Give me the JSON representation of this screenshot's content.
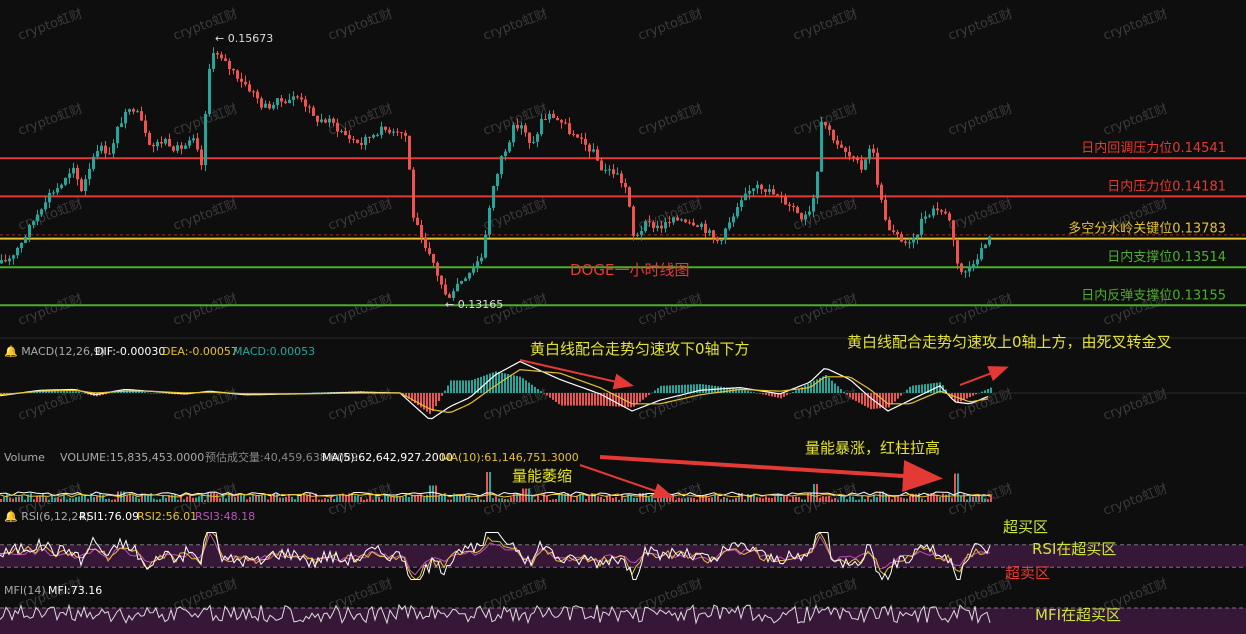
{
  "chart_data": {
    "type": "candlestick",
    "title": "DOGE一小时线图",
    "watermark": "crypto虹财",
    "price_range": [
      0.1296,
      0.159
    ],
    "high_marker": "← 0.15673",
    "low_marker": "← 0.13165",
    "levels": [
      {
        "label": "日内回调压力位0.14541",
        "value": 0.14541,
        "color": "#e53935"
      },
      {
        "label": "日内压力位0.14181",
        "value": 0.14181,
        "color": "#e53935"
      },
      {
        "label": "多空分水岭关键位0.13783",
        "value": 0.13783,
        "color": "#e5c22e"
      },
      {
        "label": "日内支撑位0.13514",
        "value": 0.13514,
        "color": "#4caf2a"
      },
      {
        "label": "日内反弹支撑位0.13155",
        "value": 0.13155,
        "color": "#4caf2a"
      }
    ],
    "price_anchors": [
      [
        0,
        0.1355
      ],
      [
        10,
        0.1362
      ],
      [
        25,
        0.1383
      ],
      [
        45,
        0.1418
      ],
      [
        60,
        0.143
      ],
      [
        72,
        0.1442
      ],
      [
        80,
        0.1425
      ],
      [
        95,
        0.1465
      ],
      [
        110,
        0.146
      ],
      [
        118,
        0.1488
      ],
      [
        135,
        0.1505
      ],
      [
        150,
        0.1465
      ],
      [
        165,
        0.1472
      ],
      [
        175,
        0.1462
      ],
      [
        192,
        0.147
      ],
      [
        200,
        0.1448
      ],
      [
        210,
        0.156
      ],
      [
        218,
        0.1548
      ],
      [
        230,
        0.1538
      ],
      [
        250,
        0.1518
      ],
      [
        262,
        0.1502
      ],
      [
        285,
        0.151
      ],
      [
        300,
        0.1512
      ],
      [
        312,
        0.1492
      ],
      [
        330,
        0.1488
      ],
      [
        345,
        0.1475
      ],
      [
        360,
        0.1468
      ],
      [
        375,
        0.148
      ],
      [
        395,
        0.1482
      ],
      [
        405,
        0.1475
      ],
      [
        412,
        0.14
      ],
      [
        422,
        0.137
      ],
      [
        432,
        0.1355
      ],
      [
        445,
        0.1322
      ],
      [
        455,
        0.1335
      ],
      [
        470,
        0.135
      ],
      [
        480,
        0.1362
      ],
      [
        490,
        0.1418
      ],
      [
        500,
        0.1455
      ],
      [
        512,
        0.1482
      ],
      [
        520,
        0.1486
      ],
      [
        530,
        0.1462
      ],
      [
        540,
        0.149
      ],
      [
        550,
        0.1495
      ],
      [
        560,
        0.1488
      ],
      [
        575,
        0.1472
      ],
      [
        590,
        0.1462
      ],
      [
        600,
        0.1445
      ],
      [
        615,
        0.144
      ],
      [
        625,
        0.1425
      ],
      [
        632,
        0.138
      ],
      [
        645,
        0.1392
      ],
      [
        660,
        0.139
      ],
      [
        680,
        0.1398
      ],
      [
        700,
        0.1392
      ],
      [
        715,
        0.1375
      ],
      [
        730,
        0.1395
      ],
      [
        740,
        0.1412
      ],
      [
        755,
        0.1432
      ],
      [
        775,
        0.1418
      ],
      [
        790,
        0.141
      ],
      [
        800,
        0.14
      ],
      [
        810,
        0.1408
      ],
      [
        815,
        0.1432
      ],
      [
        820,
        0.1492
      ],
      [
        828,
        0.148
      ],
      [
        840,
        0.1462
      ],
      [
        860,
        0.1445
      ],
      [
        870,
        0.147
      ],
      [
        878,
        0.142
      ],
      [
        888,
        0.1385
      ],
      [
        900,
        0.1378
      ],
      [
        910,
        0.137
      ],
      [
        922,
        0.14
      ],
      [
        935,
        0.1408
      ],
      [
        948,
        0.1398
      ],
      [
        955,
        0.136
      ],
      [
        962,
        0.1343
      ],
      [
        970,
        0.1355
      ],
      [
        980,
        0.1368
      ],
      [
        990,
        0.138
      ]
    ],
    "macd": {
      "label": "MACD(12,26,9)",
      "dif": "DIF:-0.00030",
      "dea": "DEA:-0.00057",
      "macd": "MACD:0.00053",
      "dif_anchors": [
        [
          0,
          -0.0003
        ],
        [
          40,
          0.0003
        ],
        [
          75,
          0.0004
        ],
        [
          95,
          -0.0002
        ],
        [
          125,
          0.0004
        ],
        [
          150,
          0.0002
        ],
        [
          185,
          -0.0001
        ],
        [
          210,
          0.0002
        ],
        [
          245,
          -0.0002
        ],
        [
          300,
          -0.0001
        ],
        [
          360,
          0.0001
        ],
        [
          400,
          0.0
        ],
        [
          430,
          -0.003
        ],
        [
          450,
          -0.0015
        ],
        [
          470,
          -0.0005
        ],
        [
          495,
          0.002
        ],
        [
          520,
          0.0035
        ],
        [
          560,
          0.0015
        ],
        [
          600,
          -0.0001
        ],
        [
          632,
          -0.002
        ],
        [
          660,
          -0.0008
        ],
        [
          700,
          0.0003
        ],
        [
          740,
          0.0006
        ],
        [
          780,
          -0.0001
        ],
        [
          810,
          0.0012
        ],
        [
          825,
          0.0028
        ],
        [
          850,
          0.0015
        ],
        [
          870,
          -0.0005
        ],
        [
          888,
          -0.002
        ],
        [
          910,
          -0.0008
        ],
        [
          940,
          0.0008
        ],
        [
          955,
          -0.001
        ],
        [
          970,
          -0.0012
        ],
        [
          990,
          -0.0003
        ]
      ],
      "dea_anchors": [
        [
          0,
          -0.0002
        ],
        [
          40,
          0.0002
        ],
        [
          75,
          0.0003
        ],
        [
          95,
          0.0
        ],
        [
          125,
          0.0002
        ],
        [
          150,
          0.0002
        ],
        [
          185,
          0.0
        ],
        [
          210,
          0.0001
        ],
        [
          245,
          -0.0001
        ],
        [
          300,
          -0.0001
        ],
        [
          360,
          0.0
        ],
        [
          400,
          0.0
        ],
        [
          430,
          -0.0018
        ],
        [
          450,
          -0.0022
        ],
        [
          470,
          -0.0012
        ],
        [
          495,
          0.0008
        ],
        [
          520,
          0.0026
        ],
        [
          560,
          0.0022
        ],
        [
          600,
          0.0006
        ],
        [
          632,
          -0.0012
        ],
        [
          660,
          -0.0012
        ],
        [
          700,
          -0.0002
        ],
        [
          740,
          0.0004
        ],
        [
          780,
          0.0002
        ],
        [
          810,
          0.0006
        ],
        [
          825,
          0.0018
        ],
        [
          850,
          0.0018
        ],
        [
          870,
          0.0004
        ],
        [
          888,
          -0.0012
        ],
        [
          910,
          -0.0012
        ],
        [
          940,
          0.0002
        ],
        [
          955,
          -0.0004
        ],
        [
          970,
          -0.001
        ],
        [
          990,
          -0.0006
        ]
      ],
      "range": [
        -0.0045,
        0.0042
      ]
    },
    "volume": {
      "label": "Volume",
      "volume": "VOLUME:15,835,453.0000",
      "est": "预估成交量:40,459,638.6089",
      "ma5": "MA(5):62,642,927.2000",
      "ma10": "MA(10):61,146,751.3000",
      "spikes": [
        [
          488,
          1.0
        ],
        [
          432,
          0.55
        ],
        [
          525,
          0.45
        ],
        [
          815,
          0.6
        ],
        [
          955,
          0.95
        ],
        [
          120,
          0.35
        ],
        [
          210,
          0.3
        ],
        [
          300,
          0.25
        ],
        [
          640,
          0.3
        ],
        [
          740,
          0.3
        ],
        [
          880,
          0.35
        ]
      ]
    },
    "rsi": {
      "label": "RSI(6,12,24)",
      "rsi1": "RSI1:76.09",
      "rsi2": "RSI2:56.01",
      "rsi3": "RSI3:48.18",
      "overbought": 70,
      "oversold": 30
    },
    "mfi": {
      "label": "MFI(14)",
      "value": "MFI:73.16",
      "overbought": 80,
      "oversold": 20
    },
    "annotations": [
      {
        "text": "黄白线配合走势匀速攻下0轴下方",
        "color": "#e5e52e"
      },
      {
        "text": "黄白线配合走势匀速攻上0轴上方，由死叉转金叉",
        "color": "#e5e52e"
      },
      {
        "text": "量能暴涨，红柱拉高",
        "color": "#e5e52e"
      },
      {
        "text": "量能萎缩",
        "color": "#e5e52e"
      },
      {
        "text": "超买区",
        "color": "#c8e63a"
      },
      {
        "text": "RSI在超买区",
        "color": "#c8e63a"
      },
      {
        "text": "超卖区",
        "color": "#e53935"
      },
      {
        "text": "MFI在超买区",
        "color": "#c8e63a"
      }
    ],
    "colors": {
      "up": "#26a69a",
      "down": "#ef5350",
      "dif": "#ffffff",
      "dea": "#e5c22e",
      "zone": "#5a1f5a"
    }
  }
}
